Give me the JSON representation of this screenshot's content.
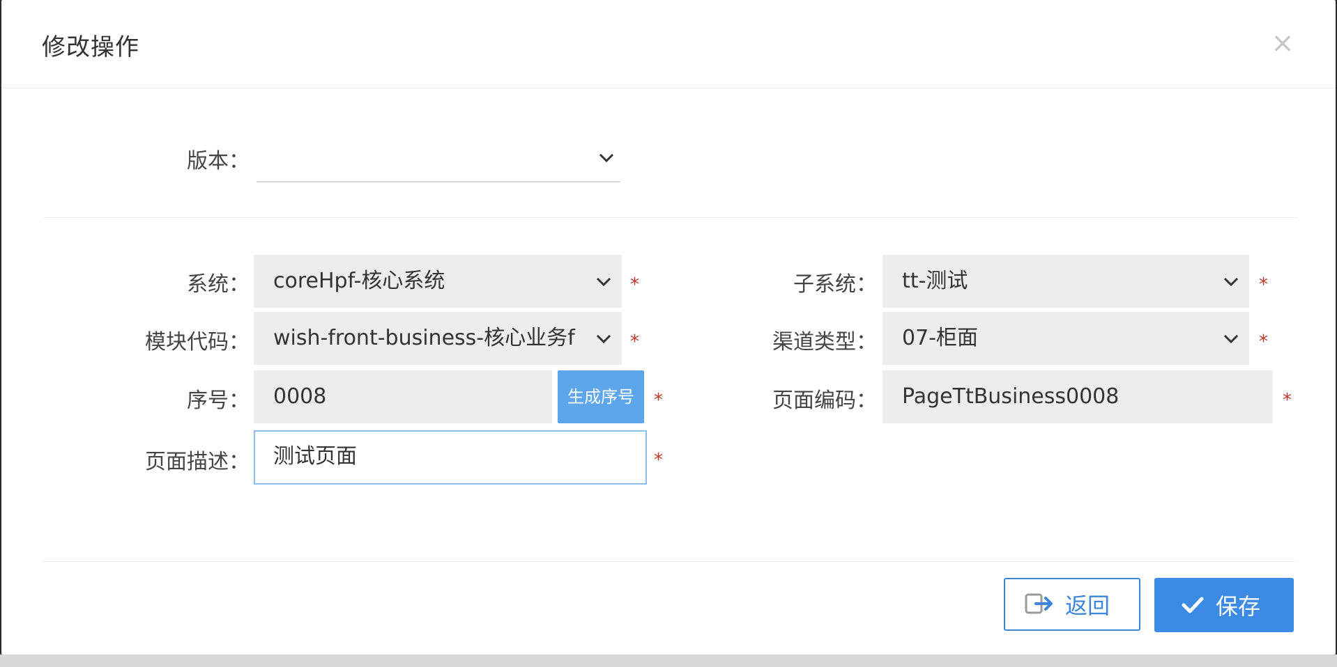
{
  "dialog": {
    "title": "修改操作",
    "close_icon": "×"
  },
  "form": {
    "version": {
      "label": "版本：",
      "value": ""
    },
    "system": {
      "label": "系统：",
      "value": "coreHpf-核心系统"
    },
    "subsystem": {
      "label": "子系统：",
      "value": "tt-测试"
    },
    "module_code": {
      "label": "模块代码：",
      "value": "wish-front-business-核心业务f"
    },
    "channel_type": {
      "label": "渠道类型：",
      "value": "07-柜面"
    },
    "sequence": {
      "label": "序号：",
      "value": "0008",
      "generate_button": "生成序号"
    },
    "page_code": {
      "label": "页面编码：",
      "value": "PageTtBusiness0008"
    },
    "page_desc": {
      "label": "页面描述：",
      "value": "测试页面"
    },
    "required_mark": "*"
  },
  "footer": {
    "back_label": "返回",
    "save_label": "保存"
  },
  "colors": {
    "primary": "#3b8ae4",
    "required": "#c0392b",
    "field_bg": "#ededed"
  }
}
